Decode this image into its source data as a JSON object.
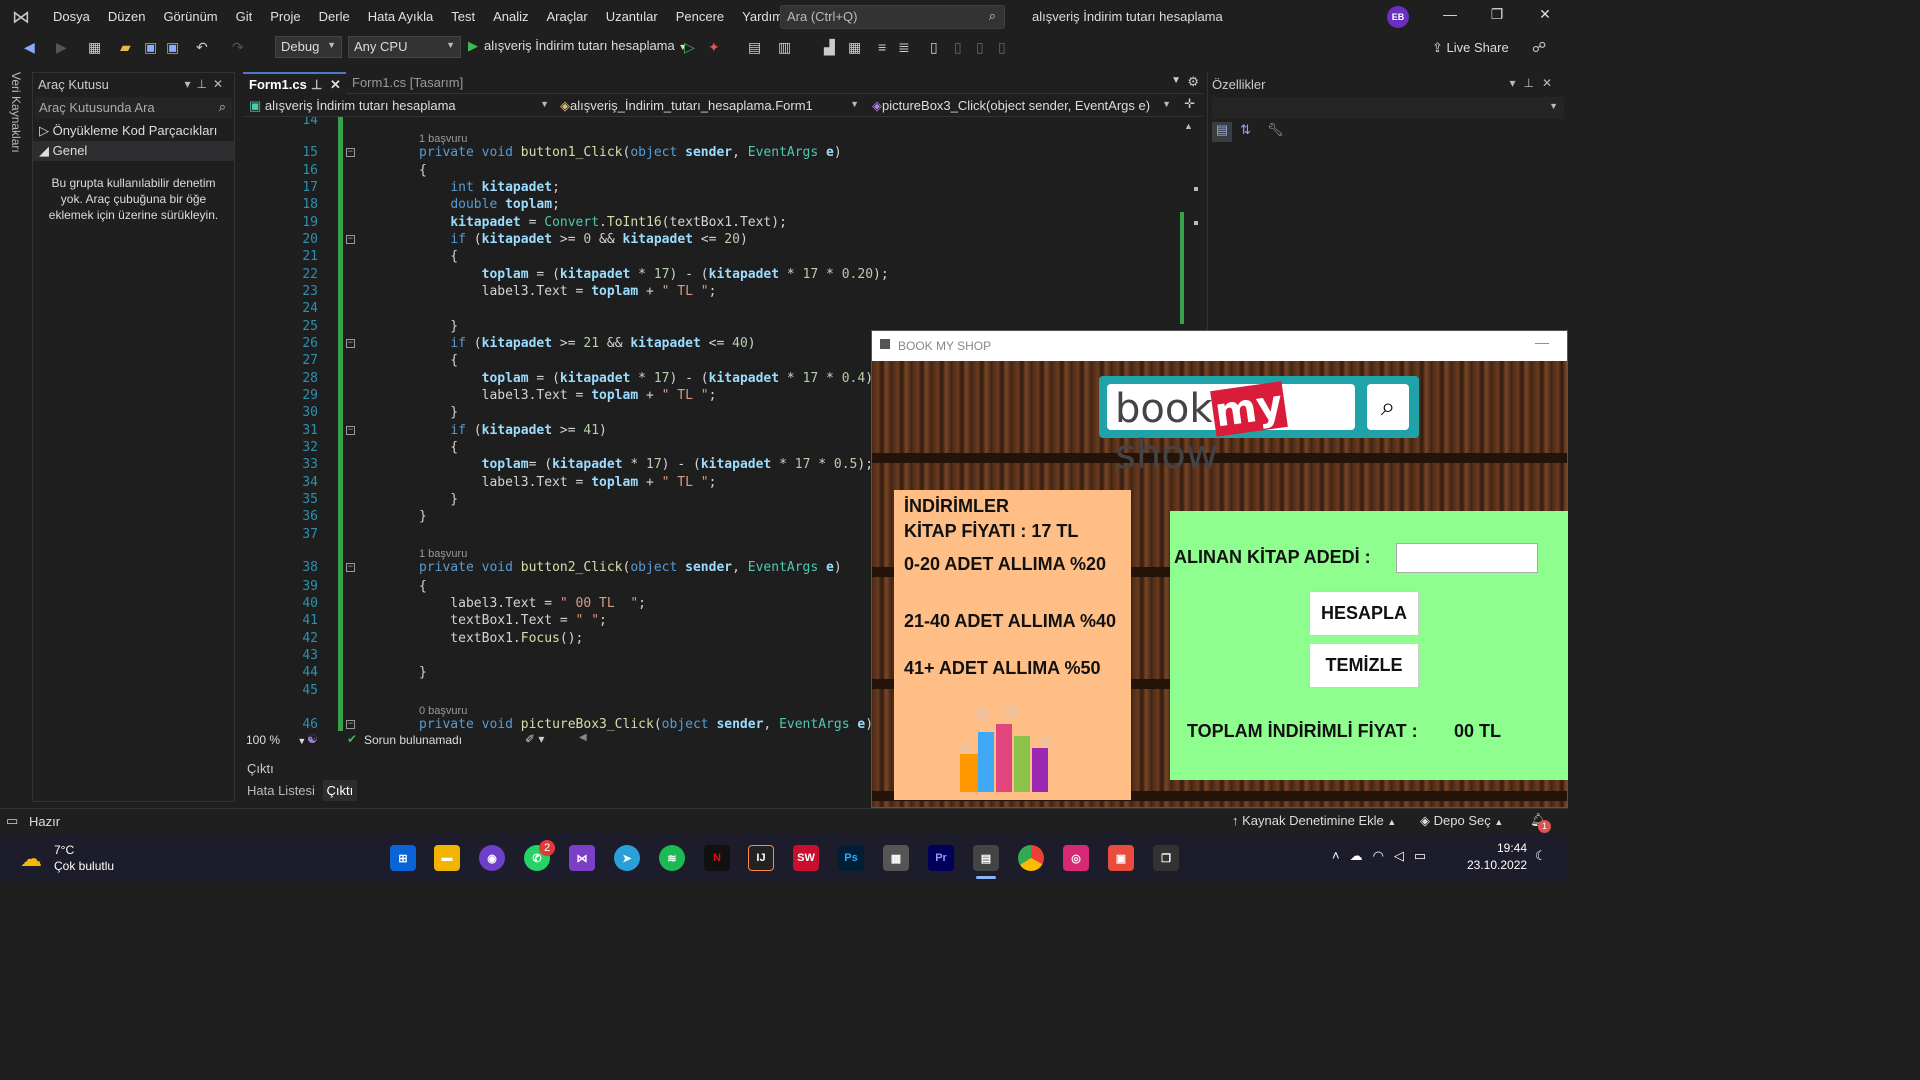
{
  "menu": [
    "Dosya",
    "Düzen",
    "Görünüm",
    "Git",
    "Proje",
    "Derle",
    "Hata Ayıkla",
    "Test",
    "Analiz",
    "Araçlar",
    "Uzantılar",
    "Pencere",
    "Yardım"
  ],
  "search_placeholder": "Ara (Ctrl+Q)",
  "window_title": "alışveriş İndirim tutarı hesaplama",
  "avatar_initials": "EB",
  "toolbar": {
    "config": "Debug",
    "platform": "Any CPU",
    "run_label": "alışveriş İndirim tutarı hesaplama",
    "live_share": "Live Share"
  },
  "left_vertical_tab": "Veri Kaynakları",
  "toolbox": {
    "title": "Araç Kutusu",
    "search": "Araç Kutusunda Ara",
    "items": [
      "Önyükleme Kod Parçacıkları",
      "Genel"
    ],
    "empty_text": "Bu grupta kullanılabilir denetim yok. Araç çubuğuna bir öğe eklemek için üzerine sürükleyin."
  },
  "editor": {
    "tabs": [
      "Form1.cs",
      "Form1.cs [Tasarım]"
    ],
    "nav": [
      "alışveriş İndirim tutarı hesaplama",
      "alışveriş_İndirim_tutarı_hesaplama.Form1",
      "pictureBox3_Click(object sender, EventArgs e)"
    ],
    "zoom": "100 %",
    "status": "Sorun bulunamadı"
  },
  "code_lines": [
    {
      "n": "14",
      "html": ""
    },
    {
      "ref": "1 başvuru"
    },
    {
      "n": "15",
      "fold": true,
      "html": "<span class='kw'>private</span> <span class='kw'>void</span> <span class='fn'>button1_Click</span>(<span class='kw'>object</span> <span class='var'>sender</span>, <span class='ty'>EventArgs</span> <span class='var'>e</span>)"
    },
    {
      "n": "16",
      "html": "{"
    },
    {
      "n": "17",
      "html": "    <span class='kw'>int</span> <span class='var'>kitapadet</span>;"
    },
    {
      "n": "18",
      "html": "    <span class='kw'>double</span> <span class='var'>toplam</span>;"
    },
    {
      "n": "19",
      "html": "    <span class='var'>kitapadet</span> = <span class='ty'>Convert</span>.<span class='fn'>ToInt16</span>(textBox1.Text);"
    },
    {
      "n": "20",
      "fold": true,
      "html": "    <span class='kw'>if</span> (<span class='var'>kitapadet</span> &gt;= <span class='nm'>0</span> &amp;&amp; <span class='var'>kitapadet</span> &lt;= <span class='nm'>20</span>)"
    },
    {
      "n": "21",
      "html": "    {"
    },
    {
      "n": "22",
      "html": "        <span class='var'>toplam</span> = (<span class='var'>kitapadet</span> * <span class='nm'>17</span>) - (<span class='var'>kitapadet</span> * <span class='nm'>17</span> * <span class='nm'>0.20</span>);"
    },
    {
      "n": "23",
      "html": "        label3.Text = <span class='var'>toplam</span> + <span class='st'>\" TL \"</span>;"
    },
    {
      "n": "24",
      "html": ""
    },
    {
      "n": "25",
      "html": "    }"
    },
    {
      "n": "26",
      "fold": true,
      "html": "    <span class='kw'>if</span> (<span class='var'>kitapadet</span> &gt;= <span class='nm'>21</span> &amp;&amp; <span class='var'>kitapadet</span> &lt;= <span class='nm'>40</span>)"
    },
    {
      "n": "27",
      "html": "    {"
    },
    {
      "n": "28",
      "html": "        <span class='var'>toplam</span> = (<span class='var'>kitapadet</span> * <span class='nm'>17</span>) - (<span class='var'>kitapadet</span> * <span class='nm'>17</span> * <span class='nm'>0.4</span>)"
    },
    {
      "n": "29",
      "html": "        label3.Text = <span class='var'>toplam</span> + <span class='st'>\" TL \"</span>;"
    },
    {
      "n": "30",
      "html": "    }"
    },
    {
      "n": "31",
      "fold": true,
      "html": "    <span class='kw'>if</span> (<span class='var'>kitapadet</span> &gt;= <span class='nm'>41</span>)"
    },
    {
      "n": "32",
      "html": "    {"
    },
    {
      "n": "33",
      "html": "        <span class='var'>toplam</span>= (<span class='var'>kitapadet</span> * <span class='nm'>17</span>) - (<span class='var'>kitapadet</span> * <span class='nm'>17</span> * <span class='nm'>0.5</span>);"
    },
    {
      "n": "34",
      "html": "        label3.Text = <span class='var'>toplam</span> + <span class='st'>\" TL \"</span>;"
    },
    {
      "n": "35",
      "html": "    }"
    },
    {
      "n": "36",
      "html": "}"
    },
    {
      "n": "37",
      "html": ""
    },
    {
      "ref": "1 başvuru"
    },
    {
      "n": "38",
      "fold": true,
      "html": "<span class='kw'>private</span> <span class='kw'>void</span> <span class='fn'>button2_Click</span>(<span class='kw'>object</span> <span class='var'>sender</span>, <span class='ty'>EventArgs</span> <span class='var'>e</span>)"
    },
    {
      "n": "39",
      "html": "{"
    },
    {
      "n": "40",
      "html": "    label3.Text = <span class='st'>\" 00 TL  \"</span>;"
    },
    {
      "n": "41",
      "html": "    textBox1.Text = <span class='st'>\" \"</span>;"
    },
    {
      "n": "42",
      "html": "    textBox1.<span class='fn'>Focus</span>();"
    },
    {
      "n": "43",
      "html": ""
    },
    {
      "n": "44",
      "html": "}"
    },
    {
      "n": "45",
      "html": ""
    },
    {
      "ref": "0 başvuru"
    },
    {
      "n": "46",
      "fold": true,
      "html": "<span class='kw'>private</span> <span class='kw'>void</span> <span class='fn'>pictureBox3_Click</span>(<span class='kw'>object</span> <span class='var'>sender</span>, <span class='ty'>EventArgs</span> <span class='var'>e</span>)"
    }
  ],
  "output": {
    "title": "Çıktı",
    "tabs": [
      "Hata Listesi",
      "Çıktı"
    ]
  },
  "properties": {
    "title": "Özellikler"
  },
  "statusbar": {
    "ready": "Hazır",
    "source_control": "Kaynak Denetimine Ekle",
    "repo": "Depo Seç",
    "notifications": "1"
  },
  "taskbar": {
    "weather_temp": "7°C",
    "weather_desc": "Çok bulutlu",
    "time": "19:44",
    "date": "23.10.2022",
    "whatsapp_badge": "2"
  },
  "form": {
    "title": "BOOK MY SHOP",
    "logo_book": "book",
    "logo_my": "my",
    "logo_show": "show",
    "promo": [
      "İNDİRİMLER",
      "KİTAP FİYATI :  17 TL",
      "0-20 ADET ALLIMA %20",
      "21-40 ADET ALLIMA %40",
      "41+ ADET ALLIMA %50"
    ],
    "count_label": "ALINAN KİTAP ADEDİ :",
    "count_value": "",
    "btn_calc": "HESAPLA",
    "btn_clear": "TEMİZLE",
    "total_label": "TOPLAM İNDİRİMLİ FİYAT :",
    "total_value": "00 TL"
  }
}
